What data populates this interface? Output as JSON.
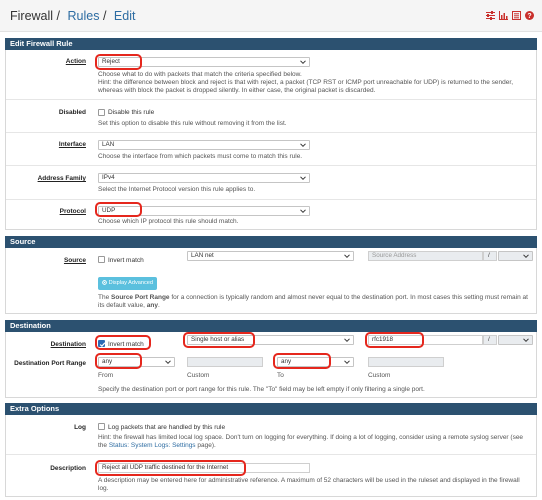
{
  "breadcrumb": {
    "part1": "Firewall",
    "part2": "Rules",
    "part3": "Edit"
  },
  "header_icons": [
    "sliders-icon",
    "chart-icon",
    "list-icon",
    "help-icon"
  ],
  "colors": {
    "panel_heading": "#2c5170",
    "highlight": "#e5271d",
    "link": "#2d6ca2",
    "info_button": "#5bc0de",
    "help_icon": "#c9302c"
  },
  "edit_rule": {
    "heading": "Edit Firewall Rule",
    "action": {
      "label": "Action",
      "value": "Reject",
      "help1": "Choose what to do with packets that match the criteria specified below.",
      "help2": "Hint: the difference between block and reject is that with reject, a packet (TCP RST or ICMP port unreachable for UDP) is returned to the sender,",
      "help3": "whereas with block the packet is dropped silently. In either case, the original packet is discarded."
    },
    "disabled": {
      "label": "Disabled",
      "checkbox_label": "Disable this rule",
      "help": "Set this option to disable this rule without removing it from the list."
    },
    "interface": {
      "label": "Interface",
      "value": "LAN",
      "help": "Choose the interface from which packets must come to match this rule."
    },
    "address_family": {
      "label": "Address Family",
      "value": "IPv4",
      "help": "Select the Internet Protocol version this rule applies to."
    },
    "protocol": {
      "label": "Protocol",
      "value": "UDP",
      "help": "Choose which IP protocol this rule should match."
    }
  },
  "source": {
    "heading": "Source",
    "label": "Source",
    "invert_label": "Invert match",
    "type_value": "LAN net",
    "address_placeholder": "Source Address",
    "slash": "/",
    "display_advanced": "Display Advanced",
    "help_pre": "The ",
    "help_bold": "Source Port Range",
    "help_post": " for a connection is typically random and almost never equal to the destination port. In most cases this setting must remain at",
    "help2_pre": "its default value, ",
    "help2_bold": "any",
    "help2_post": "."
  },
  "destination": {
    "heading": "Destination",
    "label": "Destination",
    "invert_label": "Invert match",
    "type_value": "Single host or alias",
    "address_value": "rfc1918",
    "slash": "/",
    "port_range_label": "Destination Port Range",
    "from_value": "any",
    "to_value": "any",
    "from_label": "From",
    "custom_label1": "Custom",
    "to_label": "To",
    "custom_label2": "Custom",
    "help": "Specify the destination port or port range for this rule. The \"To\" field may be left empty if only filtering a single port."
  },
  "extra": {
    "heading": "Extra Options",
    "log": {
      "label": "Log",
      "checkbox_label": "Log packets that are handled by this rule",
      "help1": "Hint: the firewall has limited local log space. Don't turn on logging for everything. If doing a lot of logging, consider using a remote syslog server (see",
      "help2_pre": "the ",
      "help2_link": "Status: System Logs: Settings",
      "help2_post": " page)."
    },
    "description": {
      "label": "Description",
      "value": "Reject all UDP traffic destined for the Internet",
      "help1": "A description may be entered here for administrative reference. A maximum of 52 characters will be used in the ruleset and displayed in the firewall",
      "help2": "log."
    }
  }
}
